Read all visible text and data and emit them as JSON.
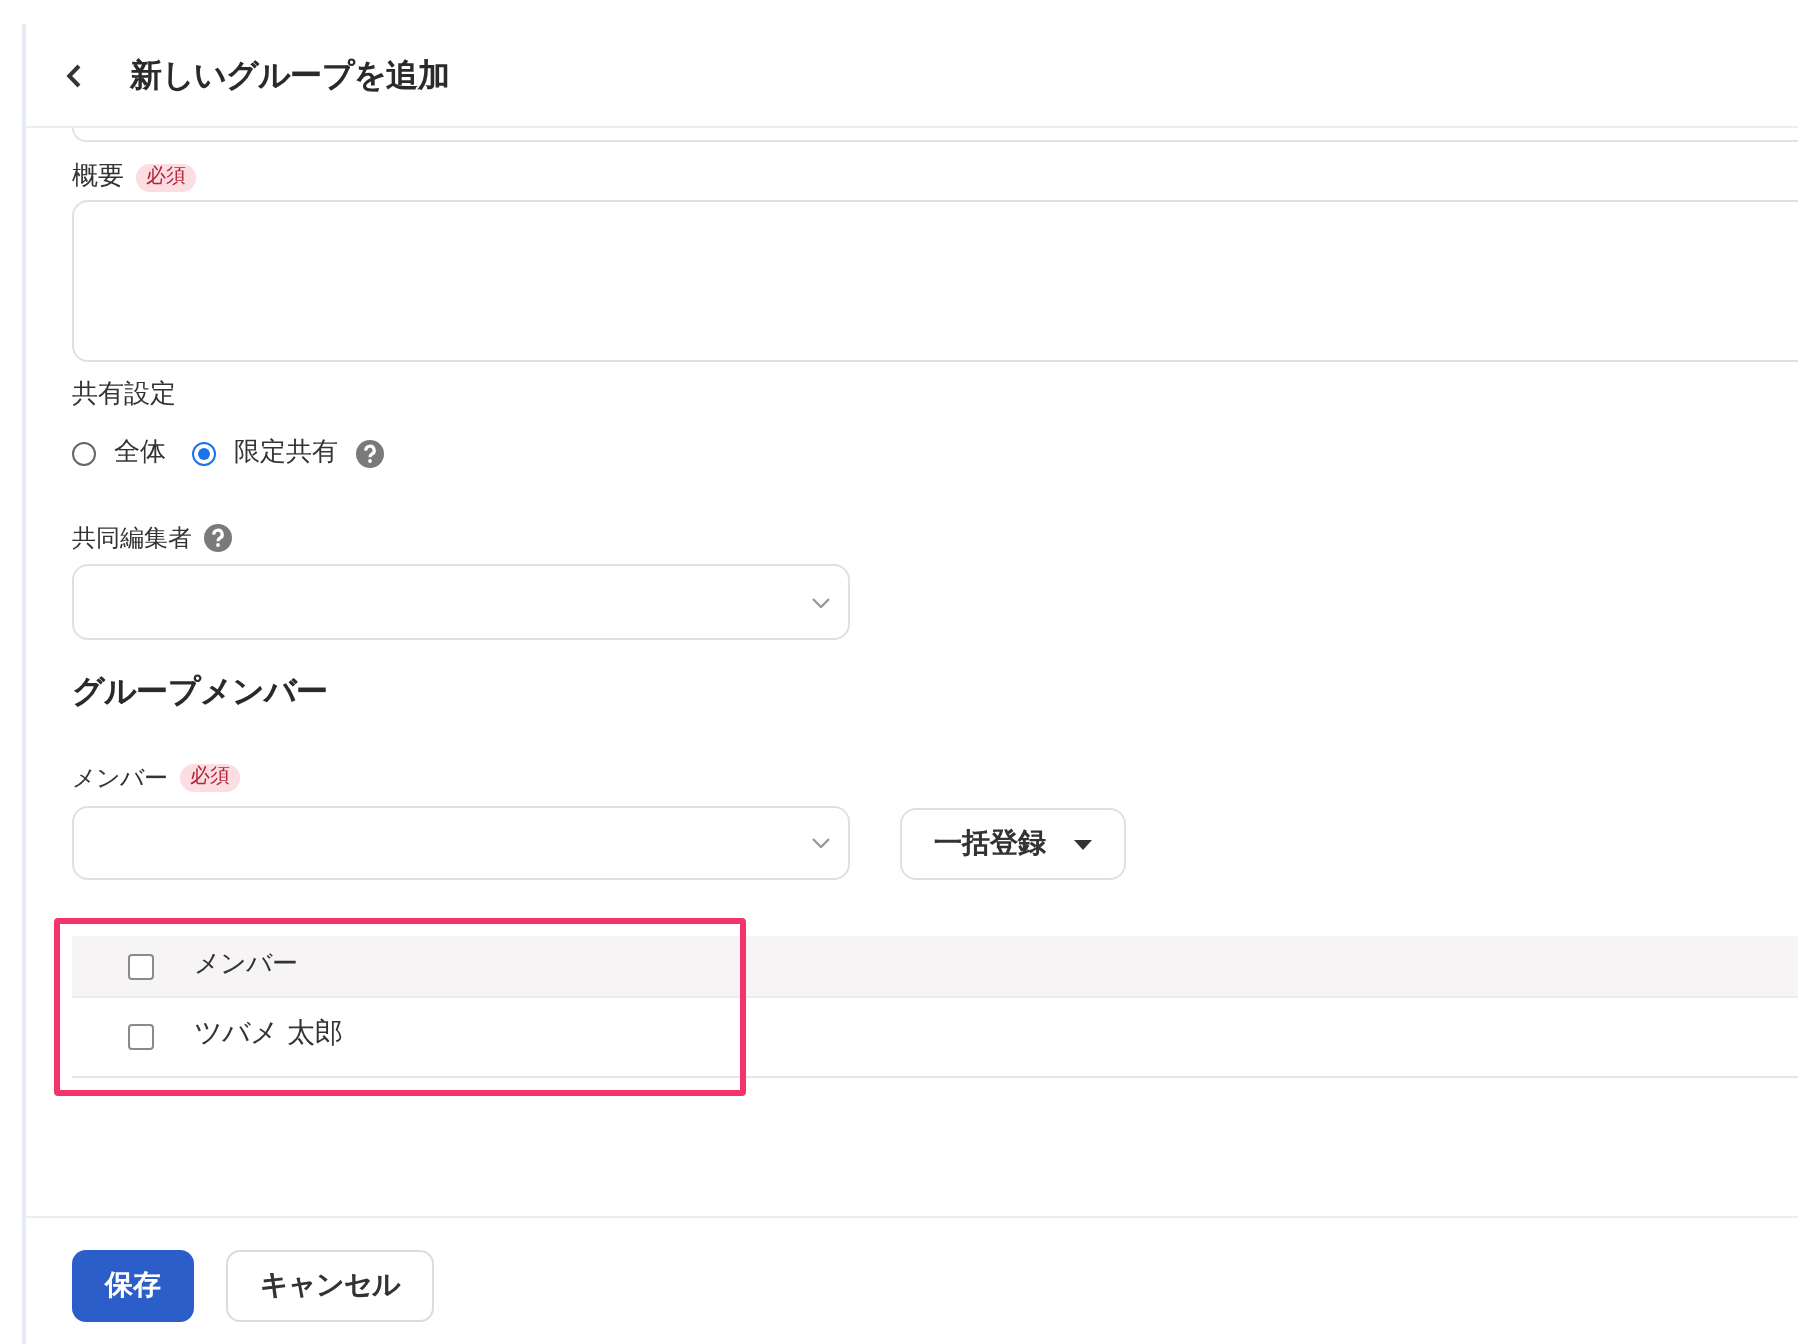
{
  "header": {
    "title": "新しいグループを追加"
  },
  "summary": {
    "label": "概要",
    "required_badge": "必須"
  },
  "sharing": {
    "label": "共有設定",
    "options": [
      {
        "label": "全体",
        "selected": false,
        "help": false
      },
      {
        "label": "限定共有",
        "selected": true,
        "help": true
      }
    ]
  },
  "co_editors": {
    "label": "共同編集者",
    "help": true
  },
  "members_section": {
    "heading": "グループメンバー"
  },
  "members": {
    "label": "メンバー",
    "required_badge": "必須",
    "bulk_button": "一括登録"
  },
  "members_table": {
    "highlighted": true,
    "header": {
      "label": "メンバー",
      "checked": false
    },
    "rows": [
      {
        "name": "ツバメ 太郎",
        "checked": false
      }
    ]
  },
  "footer": {
    "buttons": [
      {
        "label": "保存",
        "kind": "primary"
      },
      {
        "label": "キャンセル",
        "kind": "secondary"
      }
    ]
  }
}
